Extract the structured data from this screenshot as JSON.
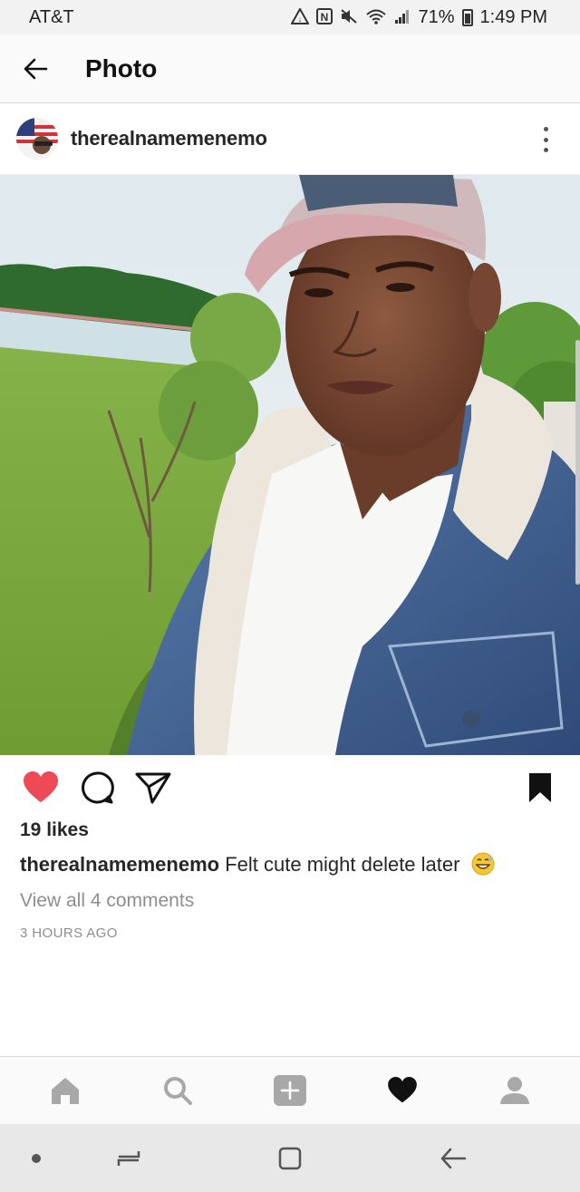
{
  "status_bar": {
    "carrier": "AT&T",
    "battery": "71%",
    "time": "1:49 PM",
    "icons": [
      "data-saver-icon",
      "nfc-icon",
      "mute-icon",
      "wifi-icon",
      "signal-icon",
      "battery-icon"
    ]
  },
  "header": {
    "title": "Photo",
    "back_icon": "back-arrow-icon"
  },
  "post": {
    "username": "therealnamemenemo",
    "menu_icon": "more-vertical-icon",
    "liked": true,
    "likes": "19 likes",
    "caption_user": "therealnamemenemo",
    "caption_text": " Felt cute might delete later",
    "caption_emoji": "grinning-sweat-emoji",
    "view_comments": "View all 4 comments",
    "timestamp": "3 HOURS AGO",
    "saved": true
  },
  "actions": [
    "heart-icon",
    "comment-icon",
    "share-icon",
    "bookmark-icon"
  ],
  "bottom_nav": [
    "home-icon",
    "search-icon",
    "add-post-icon",
    "activity-heart-icon",
    "profile-icon"
  ],
  "system_nav": [
    "dot-icon",
    "recents-icon",
    "home-square-icon",
    "back-icon"
  ],
  "colors": {
    "like_red": "#ed4956",
    "text": "#262626",
    "secondary_text": "#8e8e8e",
    "divider": "#dbdbdb"
  }
}
